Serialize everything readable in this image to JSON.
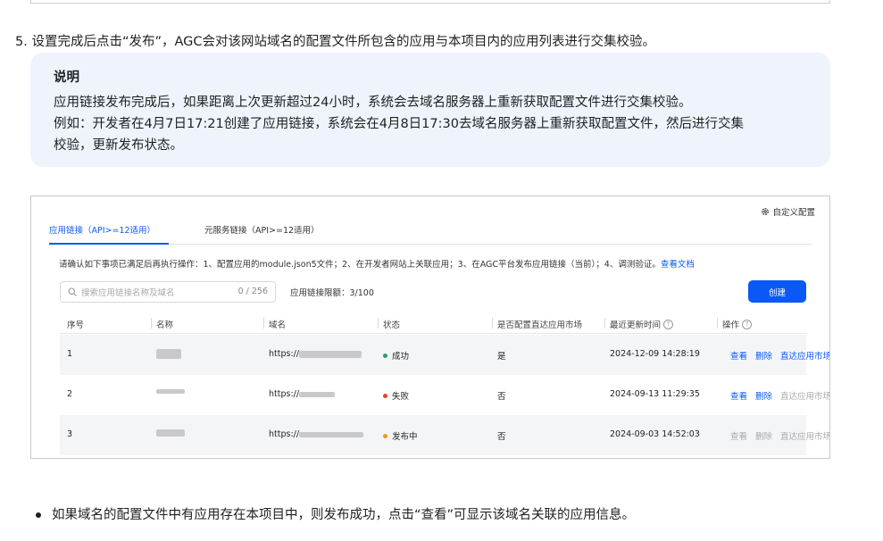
{
  "step": {
    "number": "5.",
    "text": "设置完成后点击“发布”，AGC会对该网站域名的配置文件所包含的应用与本项目内的应用列表进行交集校验。"
  },
  "note": {
    "title": "说明",
    "lines": [
      "应用链接发布完成后，如果距离上次更新超过24小时，系统会去域名服务器上重新获取配置文件进行交集校验。",
      "例如：开发者在4月7日17:21创建了应用链接，系统会在4月8日17:30去域名服务器上重新获取配置文件，然后进行交集",
      "校验，更新发布状态。"
    ]
  },
  "screenshot": {
    "custom_config": "自定义配置",
    "tabs": [
      {
        "label": "应用链接（API>=12适用）",
        "active": true
      },
      {
        "label": "元服务链接（API>=12适用）",
        "active": false
      }
    ],
    "hint": "请确认如下事项已满足后再执行操作：1、配置应用的module.json5文件；2、在开发者网站上关联应用；3、在AGC平台发布应用链接（当前）；4、调测验证。",
    "hint_link": "查看文档",
    "search": {
      "placeholder": "搜索应用链接名称及域名",
      "count": "0 / 256"
    },
    "limit": "应用链接限额：3/100",
    "create_label": "创建",
    "columns": [
      "序号",
      "名称",
      "域名",
      "状态",
      "是否配置直达应用市场",
      "最近更新时间",
      "操作"
    ],
    "rows": [
      {
        "index": "1",
        "domain_prefix": "https://",
        "status": "成功",
        "status_color": "#21a564",
        "market": "是",
        "updated": "2024-12-09 14:28:19",
        "actions": [
          {
            "label": "查看",
            "enabled": true
          },
          {
            "label": "删除",
            "enabled": true
          },
          {
            "label": "直达应用市场",
            "enabled": true
          }
        ]
      },
      {
        "index": "2",
        "domain_prefix": "https://",
        "status": "失败",
        "status_color": "#e84026",
        "market": "否",
        "updated": "2024-09-13 11:29:35",
        "actions": [
          {
            "label": "查看",
            "enabled": true
          },
          {
            "label": "删除",
            "enabled": true
          },
          {
            "label": "直达应用市场",
            "enabled": false
          }
        ]
      },
      {
        "index": "3",
        "domain_prefix": "https://",
        "status": "发布中",
        "status_color": "#f29b0a",
        "market": "否",
        "updated": "2024-09-03 14:52:03",
        "actions": [
          {
            "label": "查看",
            "enabled": false
          },
          {
            "label": "删除",
            "enabled": false
          },
          {
            "label": "直达应用市场",
            "enabled": false
          }
        ]
      }
    ]
  },
  "bullet": "如果域名的配置文件中有应用存在本项目中，则发布成功，点击“查看”可显示该域名关联的应用信息。",
  "icons": {
    "settings": "gear-icon",
    "search": "search-icon",
    "help": "help-icon"
  }
}
